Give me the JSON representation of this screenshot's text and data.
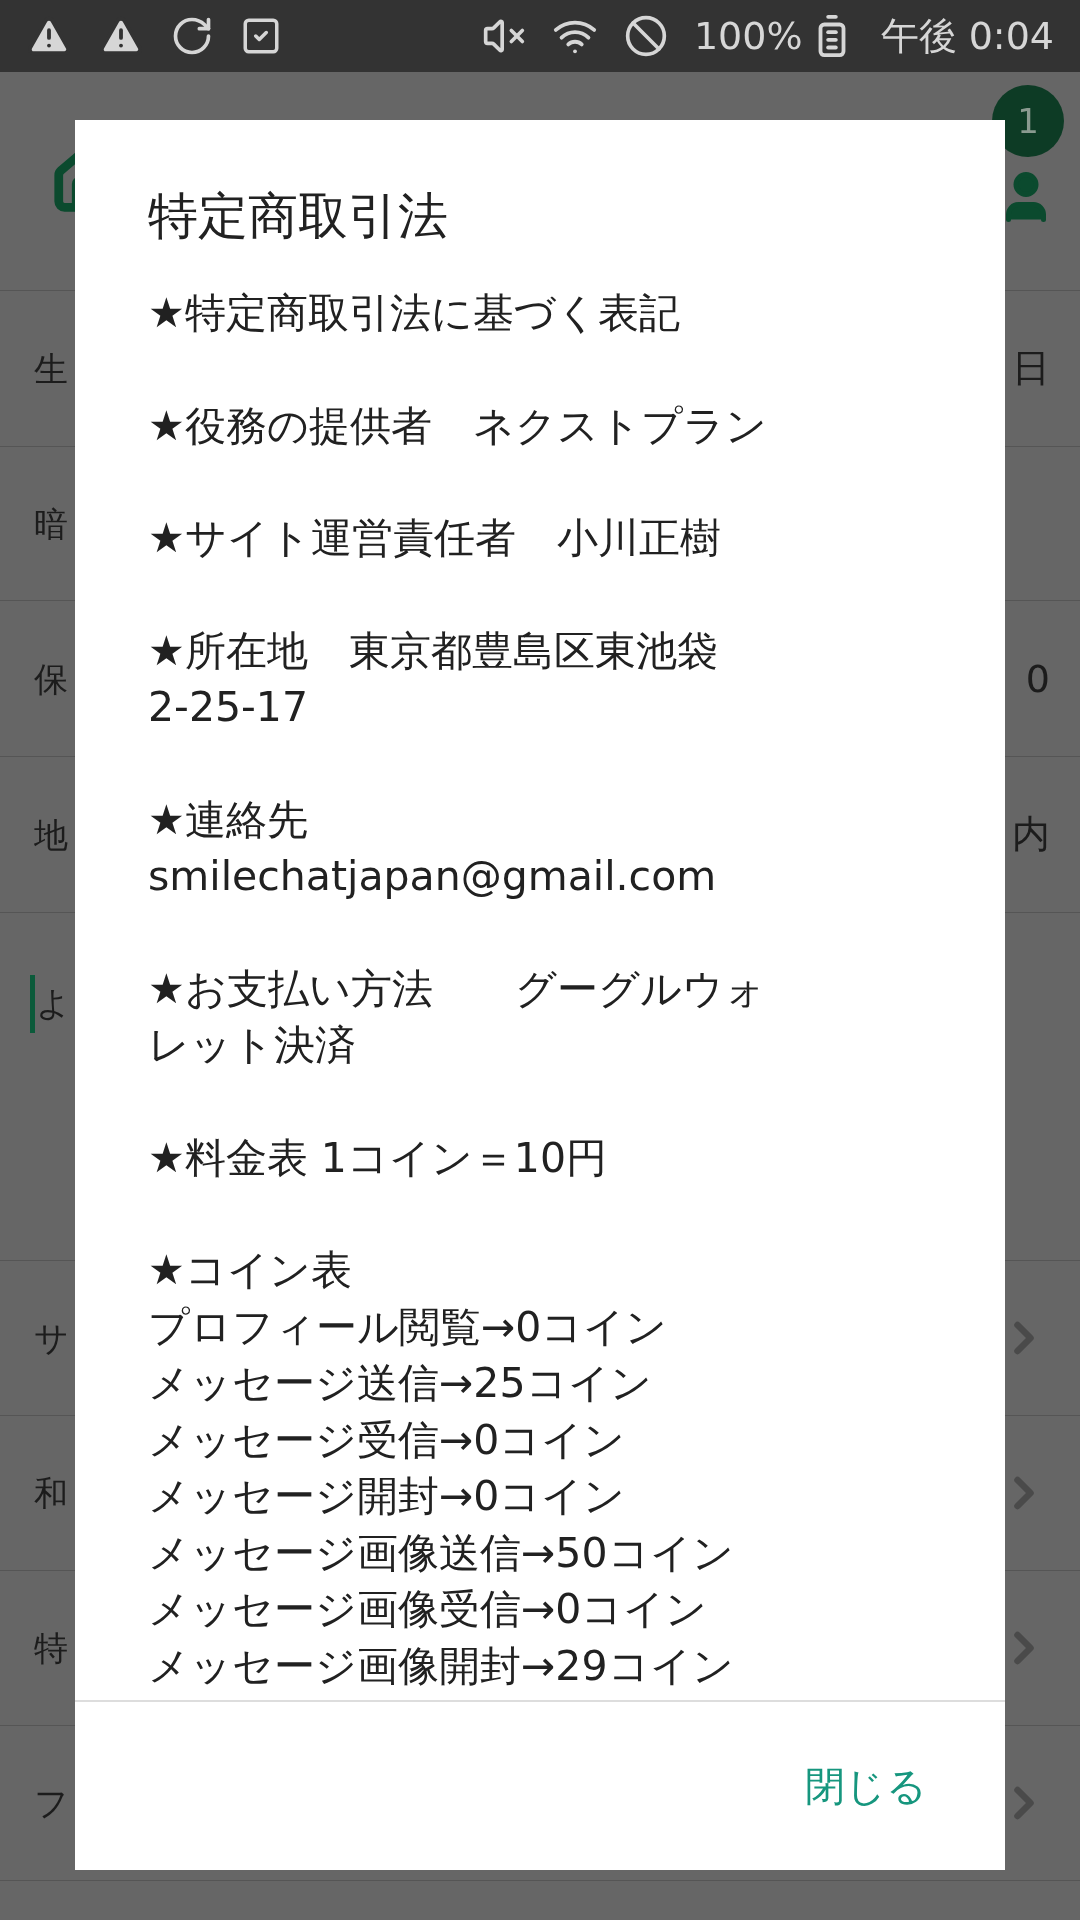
{
  "status_bar": {
    "battery": "100%",
    "time": "午後 0:04"
  },
  "header": {
    "badge": "1"
  },
  "rows": [
    {
      "kind": "value",
      "label": "生",
      "value": "日"
    },
    {
      "kind": "plain",
      "label": "暗"
    },
    {
      "kind": "value",
      "label": "保",
      "value": "0"
    },
    {
      "kind": "value",
      "label": "地",
      "value": "内"
    },
    {
      "kind": "section",
      "label": "よ"
    },
    {
      "kind": "link",
      "label": "サ"
    },
    {
      "kind": "link",
      "label": "和"
    },
    {
      "kind": "link",
      "label": "特"
    },
    {
      "kind": "link",
      "label": "フ"
    }
  ],
  "dialog": {
    "title": "特定商取引法",
    "paragraphs": [
      {
        "lines": [
          "★特定商取引法に基づく表記"
        ]
      },
      {
        "lines": [
          "★役務の提供者　ネクストプラン"
        ]
      },
      {
        "lines": [
          "★サイト運営責任者　小川正樹"
        ]
      },
      {
        "lines": [
          "★所在地　東京都豊島区東池袋",
          "2-25-17"
        ]
      },
      {
        "lines": [
          "★連絡先",
          "smilechatjapan@gmail.com"
        ]
      },
      {
        "lines": [
          "★お支払い方法　　グーグルウォ",
          "レット決済"
        ]
      },
      {
        "lines": [
          "★料金表 1コイン＝10円"
        ]
      },
      {
        "lines": [
          "★コイン表",
          "プロフィール閲覧→0コイン",
          "メッセージ送信→25コイン",
          "メッセージ受信→0コイン",
          "メッセージ開封→0コイン",
          "メッセージ画像送信→50コイン",
          "メッセージ画像受信→0コイン",
          "メッセージ画像開封→29コイン"
        ]
      }
    ],
    "button": "閉じる"
  }
}
